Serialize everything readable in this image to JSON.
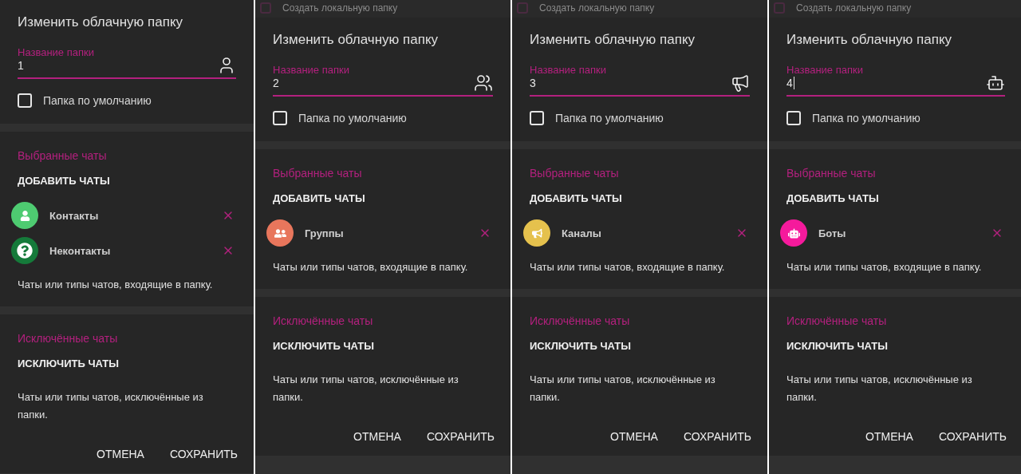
{
  "panels": [
    {
      "title": "Изменить облачную папку",
      "name_field": {
        "label": "Название папки",
        "value": "1",
        "text_cursor": false
      },
      "default_checkbox": {
        "label": "Папка по умолчанию",
        "checked": false
      },
      "included": {
        "heading": "Выбранные чаты",
        "add_button": "ДОБАВИТЬ ЧАТЫ",
        "chats": [
          {
            "name": "Контакты",
            "kind": "contacts",
            "color": "#4ecb71"
          },
          {
            "name": "Неконтакты",
            "kind": "noncontacts",
            "color": "#157a3a"
          }
        ],
        "description": "Чаты или типы чатов, входящие в папку."
      },
      "excluded": {
        "heading": "Исключённые чаты",
        "add_button": "ИСКЛЮЧИТЬ ЧАТЫ",
        "description": "Чаты или типы чатов, исключённые из папки."
      },
      "buttons": [
        "ОТМЕНА",
        "СОХРАНИТЬ"
      ]
    },
    {
      "top_row": {
        "label": "Создать локальную папку",
        "checked": false
      },
      "title": "Изменить облачную папку",
      "name_field": {
        "label": "Название папки",
        "value": "2",
        "text_cursor": false
      },
      "default_checkbox": {
        "label": "Папка по умолчанию",
        "checked": false
      },
      "included": {
        "heading": "Выбранные чаты",
        "add_button": "ДОБАВИТЬ ЧАТЫ",
        "chats": [
          {
            "name": "Группы",
            "kind": "groups",
            "color": "#e8765c"
          }
        ],
        "description": "Чаты или типы чатов, входящие в папку."
      },
      "excluded": {
        "heading": "Исключённые чаты",
        "add_button": "ИСКЛЮЧИТЬ ЧАТЫ",
        "description": "Чаты или типы чатов, исключённые из папки."
      },
      "buttons": [
        "ОТМЕНА",
        "СОХРАНИТЬ"
      ]
    },
    {
      "top_row": {
        "label": "Создать локальную папку",
        "checked": false
      },
      "title": "Изменить облачную папку",
      "name_field": {
        "label": "Название папки",
        "value": "3",
        "text_cursor": false
      },
      "default_checkbox": {
        "label": "Папка по умолчанию",
        "checked": false
      },
      "included": {
        "heading": "Выбранные чаты",
        "add_button": "ДОБАВИТЬ ЧАТЫ",
        "chats": [
          {
            "name": "Каналы",
            "kind": "channels",
            "color": "#e5c14d"
          }
        ],
        "description": "Чаты или типы чатов, входящие в папку."
      },
      "excluded": {
        "heading": "Исключённые чаты",
        "add_button": "ИСКЛЮЧИТЬ ЧАТЫ",
        "description": "Чаты или типы чатов, исключённые из папки."
      },
      "buttons": [
        "ОТМЕНА",
        "СОХРАНИТЬ"
      ]
    },
    {
      "top_row": {
        "label": "Создать локальную папку",
        "checked": false
      },
      "title": "Изменить облачную папку",
      "name_field": {
        "label": "Название папки",
        "value": "4",
        "text_cursor": true
      },
      "default_checkbox": {
        "label": "Папка по умолчанию",
        "checked": false
      },
      "included": {
        "heading": "Выбранные чаты",
        "add_button": "ДОБАВИТЬ ЧАТЫ",
        "chats": [
          {
            "name": "Боты",
            "kind": "bots",
            "color": "#f51a9c"
          }
        ],
        "description": "Чаты или типы чатов, входящие в папку."
      },
      "excluded": {
        "heading": "Исключённые чаты",
        "add_button": "ИСКЛЮЧИТЬ ЧАТЫ",
        "description": "Чаты или типы чатов, исключённые из папки."
      },
      "buttons": [
        "ОТМЕНА",
        "СОХРАНИТЬ"
      ]
    }
  ]
}
